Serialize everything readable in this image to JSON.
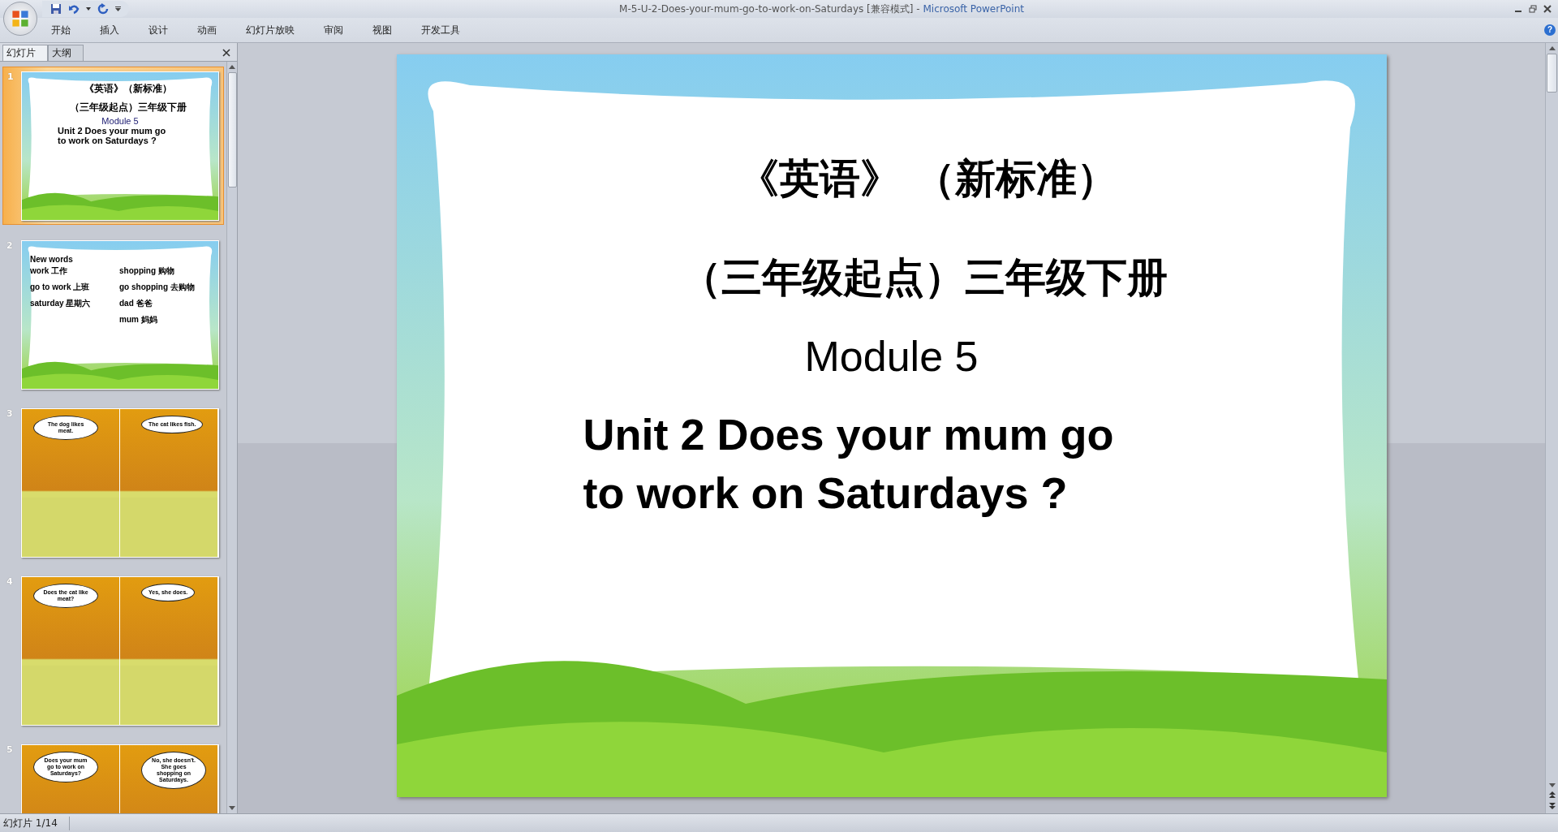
{
  "window": {
    "title": "M-5-U-2-Does-your-mum-go-to-work-on-Saturdays [兼容模式]",
    "separator": "-",
    "app_name": "Microsoft PowerPoint"
  },
  "ribbon_tabs": [
    {
      "label": "开始"
    },
    {
      "label": "插入"
    },
    {
      "label": "设计"
    },
    {
      "label": "动画"
    },
    {
      "label": "幻灯片放映"
    },
    {
      "label": "审阅"
    },
    {
      "label": "视图"
    },
    {
      "label": "开发工具"
    }
  ],
  "help_label": "?",
  "panel_tabs": [
    {
      "label": "幻灯片",
      "selected": true
    },
    {
      "label": "大纲",
      "selected": false
    }
  ],
  "thumbnails": [
    {
      "number": "1",
      "selected": true,
      "kind": "title",
      "title": "《英语》（新标准）",
      "subtitle": "（三年级起点）三年级下册",
      "module": "Module 5",
      "unit_lines": [
        "Unit 2 Does your  mum go",
        "to work on  Saturdays ?"
      ]
    },
    {
      "number": "2",
      "selected": false,
      "kind": "words",
      "heading": "New words",
      "left_words": [
        "work 工作",
        "go to work 上班",
        "saturday 星期六"
      ],
      "right_words": [
        "shopping 购物",
        "go shopping 去购物",
        "dad 爸爸",
        "mum 妈妈"
      ]
    },
    {
      "number": "3",
      "selected": false,
      "kind": "comic",
      "panels": [
        {
          "bubble": "The dog likes meat."
        },
        {
          "bubble": "The cat likes fish."
        }
      ]
    },
    {
      "number": "4",
      "selected": false,
      "kind": "comic",
      "panels": [
        {
          "bubble": "Does the cat like meat?"
        },
        {
          "bubble": "Yes, she does."
        }
      ]
    },
    {
      "number": "5",
      "selected": false,
      "kind": "comic",
      "panels": [
        {
          "bubble": "Does your mum go to work on Saturdays?"
        },
        {
          "bubble": "No, she doesn't. She goes shopping on Saturdays."
        }
      ]
    }
  ],
  "slide": {
    "title": "《英语》 （新标准）",
    "subtitle": "（三年级起点）三年级下册",
    "module": "Module 5",
    "unit_lines": [
      "Unit 2 Does your mum go",
      "to work on Saturdays ?"
    ]
  },
  "status_bar": {
    "text": "幻灯片 1/14"
  }
}
